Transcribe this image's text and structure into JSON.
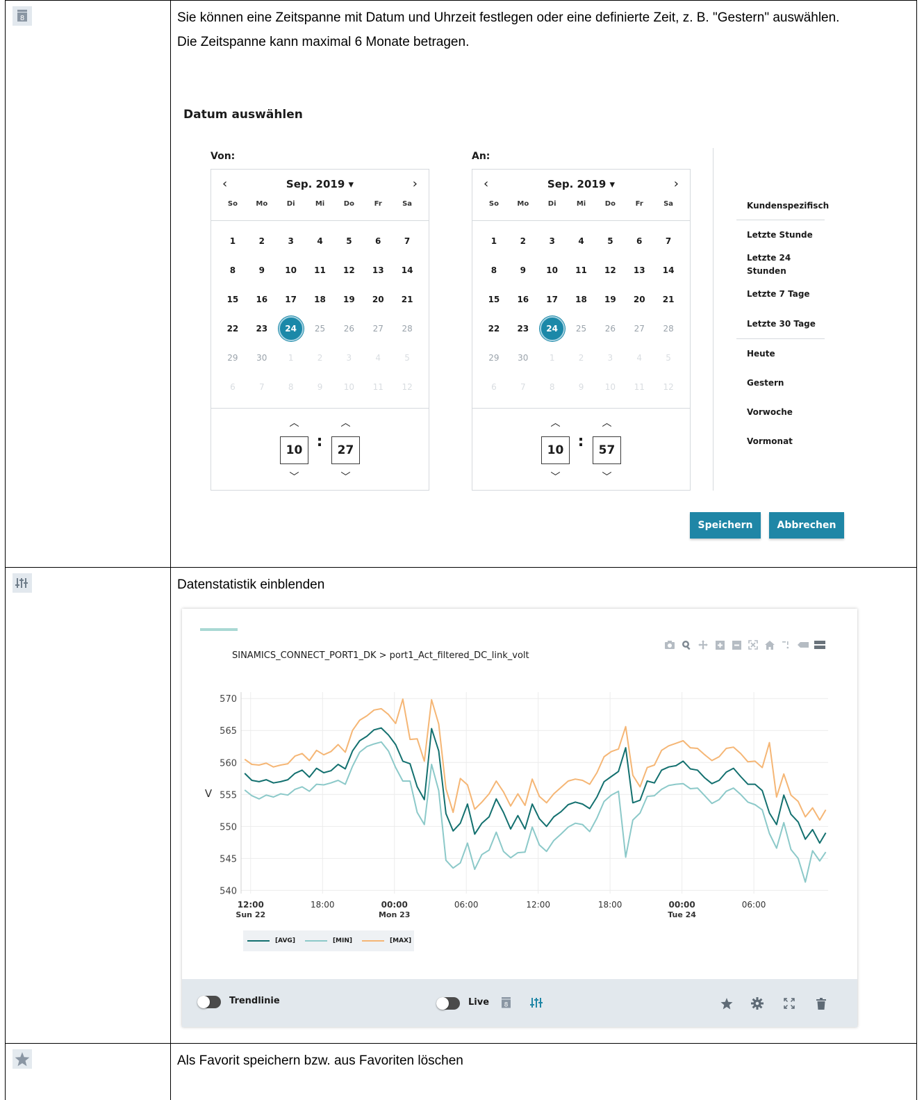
{
  "rows": [
    {
      "icon": "calendar-icon",
      "text1": "Sie können eine Zeitspanne mit Datum und Uhrzeit festlegen oder eine definierte Zeit, z. B. \"Gestern\" auswählen.",
      "text2": "Die Zeitspanne kann maximal 6 Monate betragen."
    },
    {
      "icon": "sliders-icon",
      "text": "Datenstatistik einblenden"
    },
    {
      "icon": "star-icon",
      "text": "Als Favorit speichern bzw. aus Favoriten löschen"
    }
  ],
  "datepicker": {
    "title": "Datum auswählen",
    "from": {
      "label": "Von:",
      "month": "Sep. 2019 ▾",
      "hour": "10",
      "minute": "27"
    },
    "to": {
      "label": "An:",
      "month": "Sep. 2019 ▾",
      "hour": "10",
      "minute": "57"
    },
    "weekdays": [
      "So",
      "Mo",
      "Di",
      "Mi",
      "Do",
      "Fr",
      "Sa"
    ],
    "weeks": [
      [
        "1",
        "2",
        "3",
        "4",
        "5",
        "6",
        "7"
      ],
      [
        "8",
        "9",
        "10",
        "11",
        "12",
        "13",
        "14"
      ],
      [
        "15",
        "16",
        "17",
        "18",
        "19",
        "20",
        "21"
      ],
      [
        "22",
        "23",
        "24",
        "25",
        "26",
        "27",
        "28"
      ],
      [
        "29",
        "30",
        "1",
        "2",
        "3",
        "4",
        "5"
      ],
      [
        "6",
        "7",
        "8",
        "9",
        "10",
        "11",
        "12"
      ]
    ],
    "selected_day": "24",
    "presets": [
      "Kundenspezifisch",
      "Letzte Stunde",
      "Letzte 24 Stunden",
      "Letzte 7 Tage",
      "Letzte 30 Tage",
      "Heute",
      "Gestern",
      "Vorwoche",
      "Vormonat"
    ],
    "save_label": "Speichern",
    "cancel_label": "Abbrechen",
    "accent_color": "#1f86a6"
  },
  "widget": {
    "title": "SINAMICS_CONNECT_PORT1_DK > port1_Act_filtered_DC_link_volt",
    "toolbar_icons": [
      "camera-icon",
      "zoom-icon",
      "pan-icon",
      "zoom-in-icon",
      "zoom-out-icon",
      "autoscale-icon",
      "home-icon",
      "spike-lines-icon",
      "hover-closest-icon",
      "hover-compare-icon"
    ],
    "footer": {
      "trend_label": "Trendlinie",
      "live_label": "Live"
    }
  },
  "chart_data": {
    "type": "line",
    "title": "SINAMICS_CONNECT_PORT1_DK > port1_Act_filtered_DC_link_volt",
    "xlabel": "",
    "ylabel": "V",
    "ylim": [
      539.5,
      571
    ],
    "yticks": [
      540,
      545,
      550,
      555,
      560,
      565,
      570
    ],
    "xticks": [
      {
        "h": 12,
        "label": "12:00",
        "sub": "Sun 22"
      },
      {
        "h": 18,
        "label": "18:00",
        "sub": ""
      },
      {
        "h": 24,
        "label": "00:00",
        "sub": "Mon 23"
      },
      {
        "h": 30,
        "label": "06:00",
        "sub": ""
      },
      {
        "h": 36,
        "label": "12:00",
        "sub": ""
      },
      {
        "h": 42,
        "label": "18:00",
        "sub": ""
      },
      {
        "h": 48,
        "label": "00:00",
        "sub": "Tue 24"
      },
      {
        "h": 54,
        "label": "06:00",
        "sub": ""
      }
    ],
    "grid": true,
    "x_hours_from_sun22_0000": [
      11.5,
      12,
      12.5,
      13,
      13.5,
      14,
      14.5,
      15,
      15.5,
      16,
      16.5,
      17,
      17.5,
      18,
      18.5,
      19,
      19.5,
      20,
      20.5,
      21,
      21.5,
      22,
      22.5,
      23,
      23.5,
      24,
      24.5,
      25,
      25.5,
      26,
      26.5,
      27,
      27.5,
      28,
      28.5,
      29,
      29.5,
      30,
      30.5,
      31,
      31.5,
      32,
      32.5,
      33,
      33.5,
      34,
      34.5,
      35,
      35.5,
      36,
      36.5,
      37,
      37.5,
      38,
      38.5,
      39,
      39.5,
      40,
      40.5,
      41,
      41.5,
      42,
      42.5,
      43,
      43.5,
      44,
      44.5,
      45,
      45.5,
      46,
      46.5,
      47,
      47.5,
      48,
      48.5,
      49,
      49.5,
      50,
      50.5,
      51,
      51.5,
      52,
      52.5,
      53,
      53.5,
      54,
      54.5,
      55,
      55.5,
      56,
      56.5,
      57,
      57.5,
      58,
      58.5,
      59,
      59.5,
      60
    ],
    "series": [
      {
        "name": "[AVG]",
        "color": "#13706f",
        "values": [
          558.3,
          557.2,
          557,
          557.3,
          556.8,
          557,
          557.3,
          558.3,
          558.8,
          557.7,
          559.1,
          558.4,
          558.7,
          559.7,
          559,
          561.8,
          563.4,
          564.1,
          565.1,
          565.4,
          564.3,
          562.8,
          560.2,
          559.8,
          556.2,
          554.2,
          565.3,
          561.8,
          552,
          549.3,
          550.5,
          553.5,
          548.8,
          550.5,
          551.5,
          554.3,
          552.2,
          549.6,
          551.7,
          549.6,
          553.5,
          551.2,
          550,
          551.5,
          552.3,
          553.4,
          553.8,
          553.5,
          552.8,
          554.6,
          557,
          557.8,
          558.6,
          562.3,
          553.7,
          554.1,
          557.1,
          556.8,
          558.8,
          559.3,
          559.5,
          560.2,
          559,
          558.8,
          557.6,
          556.7,
          557.2,
          558.5,
          559.1,
          557.8,
          556.6,
          556.6,
          555.6,
          552.1,
          550.3,
          554.9,
          551.9,
          550.7,
          548,
          549.5,
          547.4,
          549
        ],
        "x_offset": 11.5,
        "x_step_hours": 0.6
      },
      {
        "name": "[MIN]",
        "color": "#8cc9c9",
        "values": [
          555.7,
          554.8,
          554.3,
          554.9,
          554.6,
          555.1,
          554.9,
          555.8,
          556.2,
          555.5,
          556.6,
          556.5,
          556.8,
          557.2,
          556.6,
          559.4,
          561.6,
          562.5,
          562.9,
          563.2,
          561.8,
          559.2,
          557.1,
          557.1,
          552.2,
          550.3,
          559.7,
          555.6,
          544.7,
          543.5,
          544.3,
          547.4,
          543.3,
          545.6,
          546.3,
          549.1,
          546.1,
          545.1,
          545.9,
          546,
          549.9,
          547.1,
          546.1,
          547.8,
          548.8,
          549.9,
          550.5,
          550.3,
          549.2,
          551.3,
          553.9,
          554.9,
          555.5,
          545.2,
          551,
          552.1,
          554.7,
          554.8,
          555.8,
          556.4,
          556.6,
          556.7,
          555.9,
          556,
          554.8,
          553.6,
          554.2,
          555.5,
          556,
          555,
          553.8,
          553.4,
          552.6,
          548.9,
          546.6,
          550.6,
          546.4,
          545,
          541.3,
          546.2,
          544.6,
          546
        ],
        "x_offset": 11.5,
        "x_step_hours": 0.6
      },
      {
        "name": "[MAX]",
        "color": "#f5b675",
        "values": [
          560.5,
          559.7,
          559.6,
          559.9,
          559.3,
          559.6,
          559.8,
          561,
          561.4,
          560.3,
          561.9,
          561.2,
          561.7,
          562.8,
          561.6,
          565,
          566.6,
          567.3,
          568.2,
          568.4,
          567.5,
          566.1,
          569.9,
          563.6,
          563.7,
          560.2,
          569.8,
          566,
          555.9,
          552.2,
          557.5,
          556.5,
          552.7,
          553.8,
          555.1,
          557.1,
          555.4,
          553.2,
          555.1,
          553.3,
          557.4,
          554.7,
          553.7,
          555.1,
          556.1,
          557.1,
          557.4,
          557.2,
          556.6,
          558.4,
          560.9,
          561.7,
          562.1,
          565.6,
          558,
          556.2,
          559.2,
          559.6,
          561.9,
          562.6,
          563,
          563.4,
          562.3,
          562.2,
          561.2,
          560.3,
          560.9,
          562.2,
          562.4,
          561.4,
          560.1,
          560.2,
          559.2,
          563.1,
          554.6,
          558.2,
          554.9,
          553.9,
          551.5,
          552.9,
          551,
          552.6
        ],
        "x_offset": 11.5,
        "x_step_hours": 0.6
      }
    ]
  }
}
